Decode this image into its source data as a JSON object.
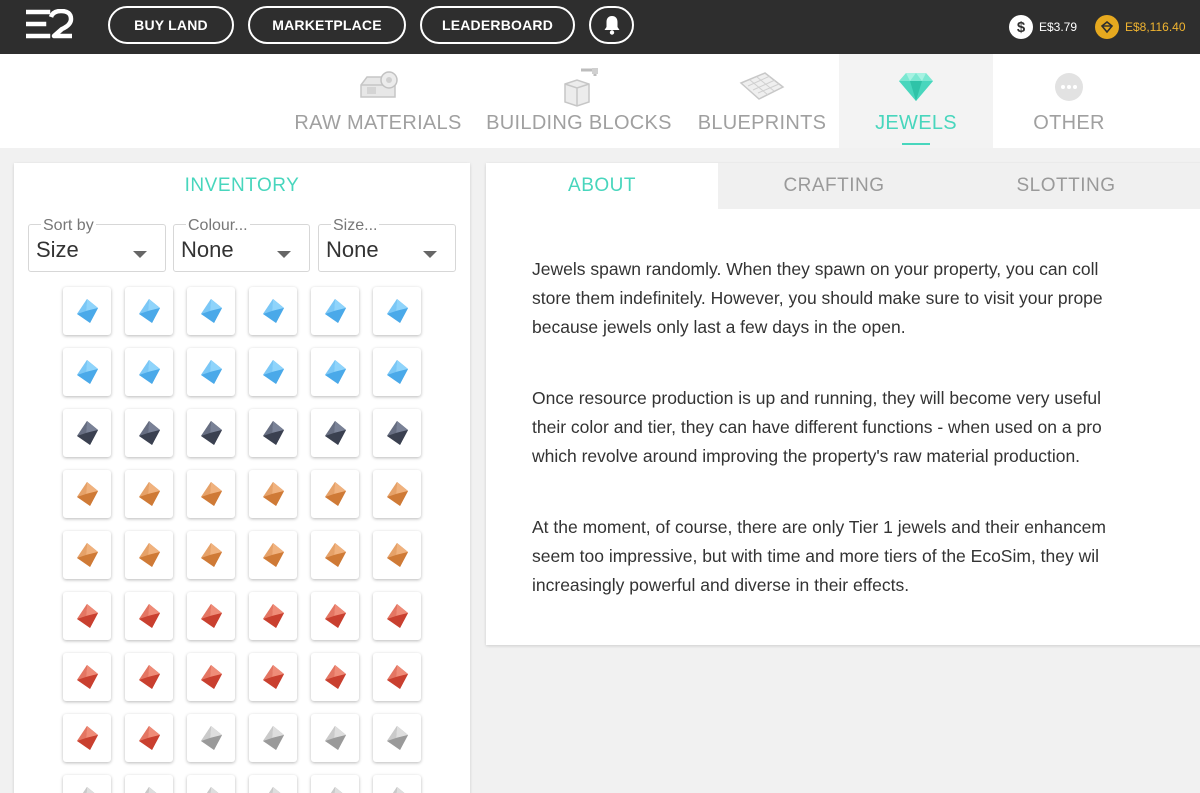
{
  "nav": {
    "buttons": [
      "BUY LAND",
      "MARKETPLACE",
      "LEADERBOARD"
    ],
    "wallet": {
      "essence": "E$3.79",
      "ether": "E$8,116.40"
    }
  },
  "categories": [
    {
      "label": "RAW MATERIALS",
      "icon": "raw-materials-icon"
    },
    {
      "label": "BUILDING BLOCKS",
      "icon": "building-blocks-icon"
    },
    {
      "label": "BLUEPRINTS",
      "icon": "blueprints-icon"
    },
    {
      "label": "JEWELS",
      "icon": "jewel-icon",
      "active": true
    },
    {
      "label": "OTHER",
      "icon": "more-icon"
    }
  ],
  "inventory": {
    "title": "INVENTORY",
    "filters": [
      {
        "label": "Sort by",
        "value": "Size"
      },
      {
        "label": "Colour...",
        "value": "None"
      },
      {
        "label": "Size...",
        "value": "None"
      }
    ],
    "jewel_colors": {
      "blue": [
        "#4aa9e9",
        "#8fd4fb"
      ],
      "dark": [
        "#3b4150",
        "#7a8297"
      ],
      "orange": [
        "#cf7a36",
        "#f0b27e"
      ],
      "red": [
        "#c9402f",
        "#ef8c78"
      ],
      "grey": [
        "#9a9a9a",
        "#dedede"
      ]
    },
    "rows": [
      [
        "blue",
        "blue",
        "blue",
        "blue",
        "blue",
        "blue"
      ],
      [
        "blue",
        "blue",
        "blue",
        "blue",
        "blue",
        "blue"
      ],
      [
        "dark",
        "dark",
        "dark",
        "dark",
        "dark",
        "dark"
      ],
      [
        "orange",
        "orange",
        "orange",
        "orange",
        "orange",
        "orange"
      ],
      [
        "orange",
        "orange",
        "orange",
        "orange",
        "orange",
        "orange"
      ],
      [
        "red",
        "red",
        "red",
        "red",
        "red",
        "red"
      ],
      [
        "red",
        "red",
        "red",
        "red",
        "red",
        "red"
      ],
      [
        "red",
        "red",
        "grey",
        "grey",
        "grey",
        "grey"
      ],
      [
        "grey",
        "grey",
        "grey",
        "grey",
        "grey",
        "grey"
      ]
    ]
  },
  "detail": {
    "tabs": [
      "ABOUT",
      "CRAFTING",
      "SLOTTING"
    ],
    "active_tab": "ABOUT",
    "paragraphs": [
      [
        "Jewels spawn randomly. When they spawn on your property, you can coll",
        "store them indefinitely. However, you should make sure to visit your prope",
        "because jewels only last a few days in the open."
      ],
      [
        "Once resource production is up and running, they will become very useful",
        "their color and tier, they can have different functions - when used on a pro",
        "which revolve around improving the property's raw material production."
      ],
      [
        "At the moment, of course, there are only Tier 1 jewels and their enhancem",
        "seem too impressive, but with time and more tiers of the EcoSim, they wil",
        "increasingly powerful and diverse in their effects."
      ]
    ]
  },
  "accent": "#48d6bd"
}
